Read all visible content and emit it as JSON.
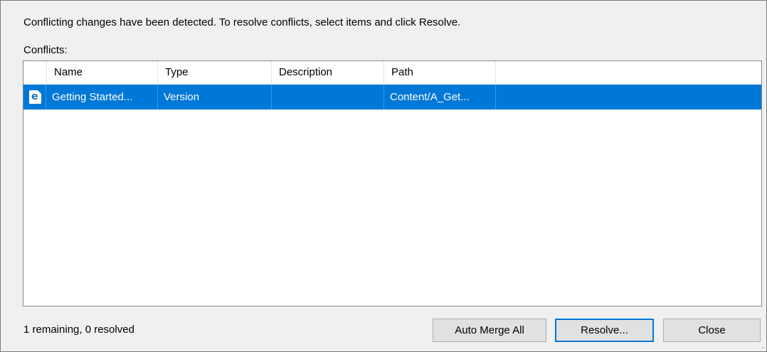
{
  "dialog": {
    "instructions": "Conflicting changes have been detected.  To resolve conflicts, select items and click Resolve.",
    "conflicts_label": "Conflicts:"
  },
  "table": {
    "columns": [
      "",
      "Name",
      "Type",
      "Description",
      "Path"
    ],
    "rows": [
      {
        "icon": "document-e-icon",
        "icon_glyph": "e",
        "name": "Getting Started...",
        "type": "Version",
        "description": "",
        "path": "Content/A_Get...",
        "selected": true
      }
    ]
  },
  "footer": {
    "status": "1 remaining, 0 resolved",
    "auto_merge_label": "Auto Merge All",
    "resolve_label": "Resolve...",
    "close_label": "Close"
  },
  "colors": {
    "selection": "#0078d7",
    "dialog_background": "#f0f0f0",
    "button_background": "#e1e1e1"
  }
}
